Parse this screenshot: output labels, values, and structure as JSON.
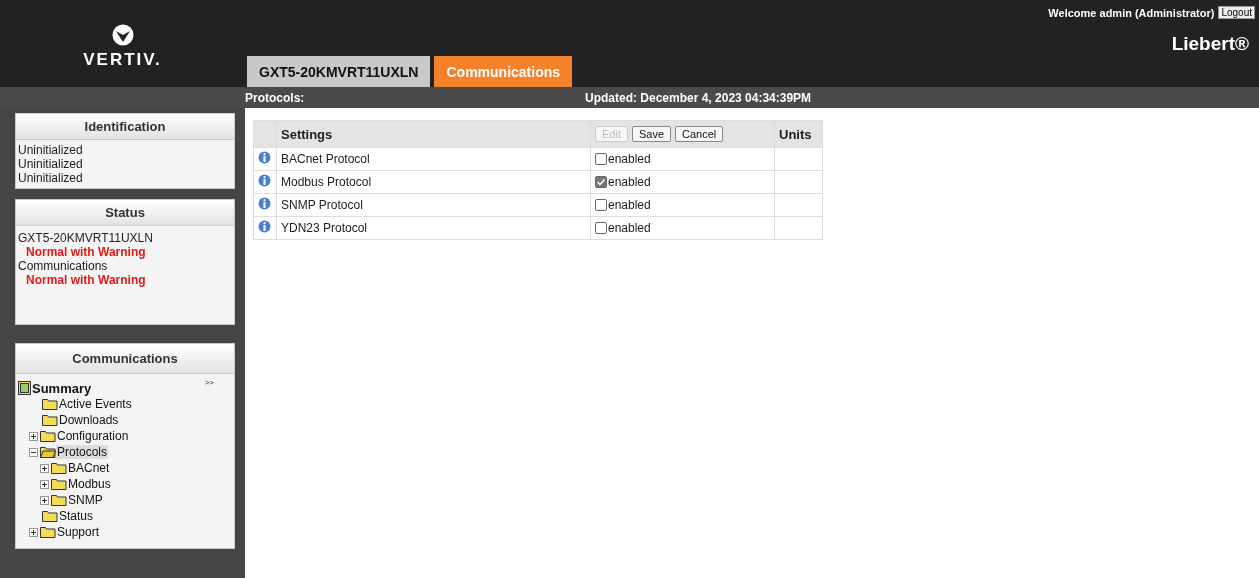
{
  "header": {
    "logo_text": "VERTIV.",
    "brand": "Liebert®",
    "welcome": "Welcome admin (Administrator)",
    "logout": "Logout",
    "tabs": [
      {
        "label": "GXT5-20KMVRT11UXLN",
        "selected": false
      },
      {
        "label": "Communications",
        "selected": true
      }
    ]
  },
  "subheader": {
    "title": "Protocols:",
    "updated": "Updated: December 4, 2023 04:34:39PM"
  },
  "sidebar": {
    "identification": {
      "title": "Identification",
      "lines": [
        "Uninitialized",
        "Uninitialized",
        "Uninitialized"
      ]
    },
    "status": {
      "title": "Status",
      "entries": [
        {
          "name": "GXT5-20KMVRT11UXLN",
          "state": "Normal with Warning"
        },
        {
          "name": "Communications",
          "state": "Normal with Warning"
        }
      ]
    },
    "communications": {
      "title": "Communications",
      "expand_toggle": ">>",
      "tree": {
        "label": "Summary",
        "kind": "book",
        "selected": false,
        "children": [
          {
            "label": "Active Events",
            "selected": false
          },
          {
            "label": "Downloads",
            "selected": false
          },
          {
            "label": "Configuration",
            "selected": false,
            "expanded": false
          },
          {
            "label": "Protocols",
            "selected": true,
            "expanded": true,
            "children": [
              {
                "label": "BACnet",
                "selected": false,
                "expanded": false
              },
              {
                "label": "Modbus",
                "selected": false,
                "expanded": false
              },
              {
                "label": "SNMP",
                "selected": false,
                "expanded": false
              }
            ]
          },
          {
            "label": "Status",
            "selected": false
          },
          {
            "label": "Support",
            "selected": false,
            "expanded": false
          }
        ]
      }
    }
  },
  "table": {
    "columns": [
      "Settings",
      "Units"
    ],
    "buttons": [
      {
        "label": "Edit",
        "disabled": true
      },
      {
        "label": "Save",
        "disabled": false
      },
      {
        "label": "Cancel",
        "disabled": false
      }
    ],
    "rows": [
      {
        "setting": "BACnet Protocol",
        "checked": false,
        "value_label": "enabled"
      },
      {
        "setting": "Modbus Protocol",
        "checked": true,
        "value_label": "enabled"
      },
      {
        "setting": "SNMP Protocol",
        "checked": false,
        "value_label": "enabled"
      },
      {
        "setting": "YDN23 Protocol",
        "checked": false,
        "value_label": "enabled"
      }
    ]
  }
}
